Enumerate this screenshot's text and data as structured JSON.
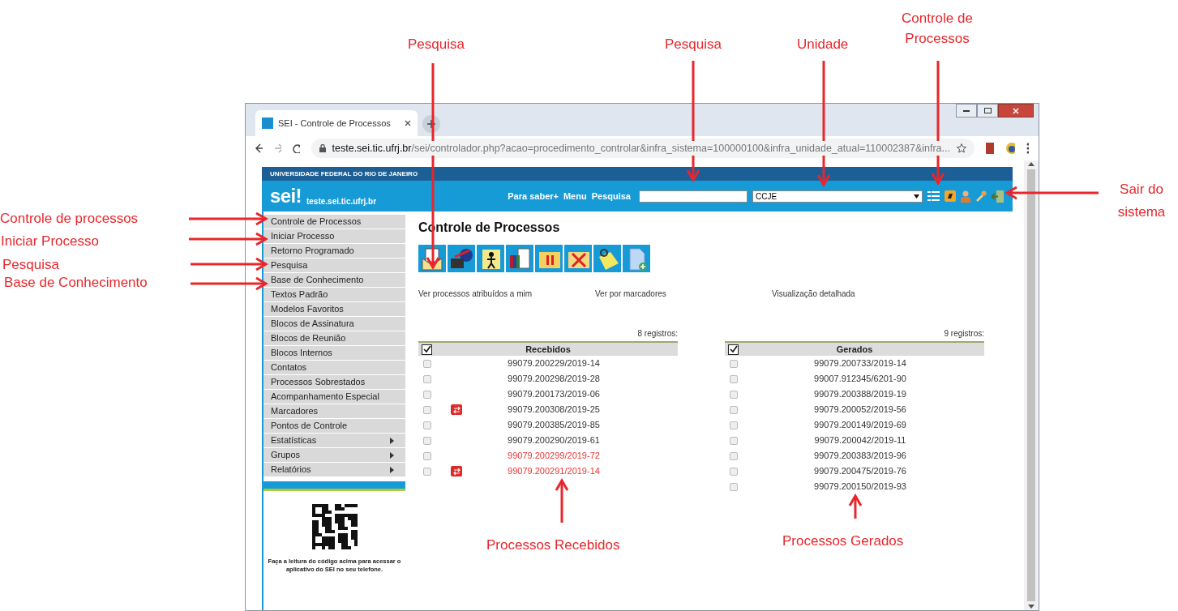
{
  "browser": {
    "tab_title": "SEI - Controle de Processos",
    "url_host": "teste.sei.tic.ufrj.br",
    "url_path": "/sei/controlador.php?acao=procedimento_controlar&infra_sistema=100000100&infra_unidade_atual=110002387&infra..."
  },
  "header": {
    "institution": "UNIVERSIDADE FEDERAL DO RIO DE JANEIRO",
    "logo": "sei!",
    "site": "teste.sei.tic.ufrj.br",
    "links": [
      "Para saber+",
      "Menu"
    ],
    "search_label": "Pesquisa",
    "unit": "CCJE"
  },
  "sidebar": {
    "items": [
      {
        "label": "Controle de Processos",
        "submenu": false
      },
      {
        "label": "Iniciar Processo",
        "submenu": false
      },
      {
        "label": "Retorno Programado",
        "submenu": false
      },
      {
        "label": "Pesquisa",
        "submenu": false
      },
      {
        "label": "Base de Conhecimento",
        "submenu": false
      },
      {
        "label": "Textos Padrão",
        "submenu": false
      },
      {
        "label": "Modelos Favoritos",
        "submenu": false
      },
      {
        "label": "Blocos de Assinatura",
        "submenu": false
      },
      {
        "label": "Blocos de Reunião",
        "submenu": false
      },
      {
        "label": "Blocos Internos",
        "submenu": false
      },
      {
        "label": "Contatos",
        "submenu": false
      },
      {
        "label": "Processos Sobrestados",
        "submenu": false
      },
      {
        "label": "Acompanhamento Especial",
        "submenu": false
      },
      {
        "label": "Marcadores",
        "submenu": false
      },
      {
        "label": "Pontos de Controle",
        "submenu": false
      },
      {
        "label": "Estatísticas",
        "submenu": true
      },
      {
        "label": "Grupos",
        "submenu": true
      },
      {
        "label": "Relatórios",
        "submenu": true
      }
    ],
    "qr_caption": "Faça a leitura do código acima para acessar o aplicativo do SEI no seu telefone."
  },
  "main": {
    "title": "Controle de Processos",
    "view_links": [
      "Ver processos atribuídos a mim",
      "Ver por marcadores",
      "Visualização detalhada"
    ],
    "tables": [
      {
        "count": "8 registros:",
        "heading": "Recebidos",
        "header_checked": true,
        "rows": [
          {
            "process": "99079.200229/2019-14",
            "checked": false,
            "marker": false,
            "highlighted": false
          },
          {
            "process": "99079.200298/2019-28",
            "checked": false,
            "marker": false,
            "highlighted": false
          },
          {
            "process": "99079.200173/2019-06",
            "checked": false,
            "marker": false,
            "highlighted": false
          },
          {
            "process": "99079.200308/2019-25",
            "checked": false,
            "marker": true,
            "highlighted": false
          },
          {
            "process": "99079.200385/2019-85",
            "checked": false,
            "marker": false,
            "highlighted": false
          },
          {
            "process": "99079.200290/2019-61",
            "checked": false,
            "marker": false,
            "highlighted": false
          },
          {
            "process": "99079.200299/2019-72",
            "checked": false,
            "marker": false,
            "highlighted": true
          },
          {
            "process": "99079.200291/2019-14",
            "checked": false,
            "marker": true,
            "highlighted": true
          }
        ]
      },
      {
        "count": "9 registros:",
        "heading": "Gerados",
        "header_checked": true,
        "rows": [
          {
            "process": "99079.200733/2019-14",
            "checked": false,
            "marker": false,
            "highlighted": false
          },
          {
            "process": "99007.912345/6201-90",
            "checked": false,
            "marker": false,
            "highlighted": false
          },
          {
            "process": "99079.200388/2019-19",
            "checked": false,
            "marker": false,
            "highlighted": false
          },
          {
            "process": "99079.200052/2019-56",
            "checked": false,
            "marker": false,
            "highlighted": false
          },
          {
            "process": "99079.200149/2019-69",
            "checked": false,
            "marker": false,
            "highlighted": false
          },
          {
            "process": "99079.200042/2019-11",
            "checked": false,
            "marker": false,
            "highlighted": false
          },
          {
            "process": "99079.200383/2019-96",
            "checked": false,
            "marker": false,
            "highlighted": false
          },
          {
            "process": "99079.200475/2019-76",
            "checked": false,
            "marker": false,
            "highlighted": false
          },
          {
            "process": "99079.200150/2019-93",
            "checked": false,
            "marker": false,
            "highlighted": false
          }
        ]
      }
    ]
  },
  "annotations": [
    {
      "text": "Pesquisa"
    },
    {
      "text": "Pesquisa"
    },
    {
      "text": "Unidade"
    },
    {
      "text": "Controle de Processos"
    },
    {
      "text": "Sair do sistema"
    },
    {
      "text": "Controle de processos"
    },
    {
      "text": "Iniciar Processo"
    },
    {
      "text": "Pesquisa"
    },
    {
      "text": "Base de Conhecimento"
    },
    {
      "text": "Processos Recebidos"
    },
    {
      "text": "Processos Gerados"
    }
  ]
}
